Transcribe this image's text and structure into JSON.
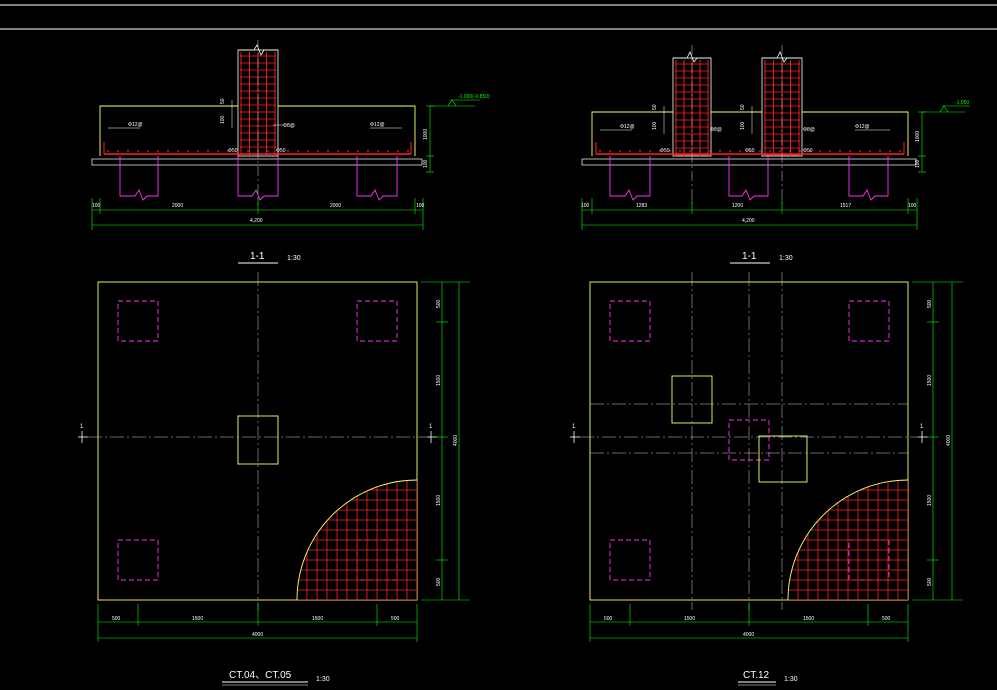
{
  "colors": {
    "background": "#000000",
    "outline": "#ffff66",
    "rebar": "#ff2020",
    "pile": "#ff33ff",
    "dimension": "#00ff00",
    "centerline": "#cccccc",
    "text": "#ffffff"
  },
  "left_section": {
    "label": "1-1",
    "scale": "1:30",
    "level": "-1.000(-0.850)",
    "bar_top": "Φ12@",
    "bar_top_right": "Φ12@",
    "col_bar": "Φ8@",
    "cover_left": "Φ50",
    "cover_right": "Φ50",
    "col_dim_a": "50",
    "col_dim_b": "100",
    "height_dim": "1000",
    "pile_dim": "100",
    "dims_bottom": [
      "100",
      "2000",
      "2000",
      "100"
    ],
    "total": "4,200"
  },
  "right_section": {
    "label": "1-1",
    "scale": "1:30",
    "level": "-1.050",
    "bar_top": "Φ12@",
    "bar_top_right": "Φ12@",
    "col_bar_a": "Φ8@",
    "col_bar_b": "Φ8@",
    "cover_a": "Φ50",
    "cover_b": "Φ50",
    "cover_c": "Φ50",
    "height_dim": "1000",
    "pile_dim": "100",
    "col_dim_a": "50",
    "col_dim_b": "100",
    "col_dim_c": "50",
    "col_dim_d": "100",
    "dims_bottom": [
      "100",
      "1283",
      "1200",
      "1517",
      "100"
    ],
    "total": "4,200"
  },
  "left_plan": {
    "name": "CT.04、CT.05",
    "scale": "1:30",
    "section_mark_left": "1",
    "section_mark_right": "1",
    "dims_bottom": [
      "500",
      "1500",
      "1500",
      "500"
    ],
    "total_bottom": "4000",
    "dims_right": [
      "500",
      "1500",
      "1500",
      "500"
    ],
    "total_right": "4000"
  },
  "right_plan": {
    "name": "CT.12",
    "scale": "1:30",
    "section_mark_left": "1",
    "section_mark_right": "1",
    "dims_bottom": [
      "500",
      "1500",
      "1500",
      "500"
    ],
    "total_bottom": "4000",
    "dims_right": [
      "500",
      "1500",
      "1500",
      "500"
    ],
    "total_right": "4000"
  }
}
